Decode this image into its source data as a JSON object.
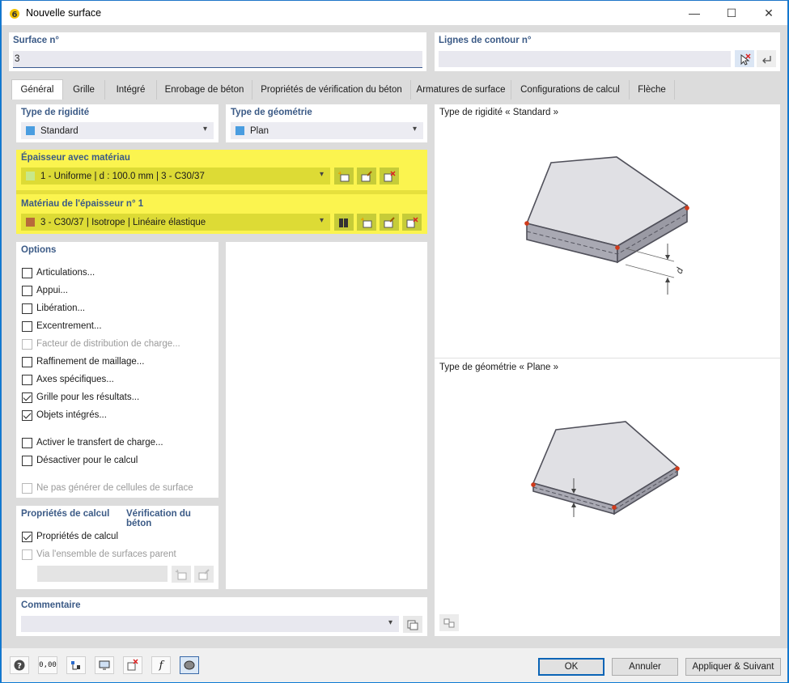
{
  "window": {
    "title": "Nouvelle surface",
    "min": "—",
    "max": "☐",
    "close": "✕"
  },
  "surface": {
    "label": "Surface n°",
    "value": "3"
  },
  "contour": {
    "label": "Lignes de contour n°",
    "value": ""
  },
  "tabs": [
    "Général",
    "Grille",
    "Intégré",
    "Enrobage de béton",
    "Propriétés de vérification du béton",
    "Armatures de surface",
    "Configurations de calcul",
    "Flèche"
  ],
  "rigidity": {
    "label": "Type de rigidité",
    "value": "Standard",
    "color": "#4a9de0"
  },
  "geometry": {
    "label": "Type de géométrie",
    "value": "Plan",
    "color": "#4a9de0"
  },
  "thickness": {
    "label": "Épaisseur avec matériau",
    "value": "1 - Uniforme | d : 100.0 mm | 3 - C30/37",
    "color": "#c8e88a"
  },
  "material": {
    "label": "Matériau de l'épaisseur n° 1",
    "value": "3 - C30/37 | Isotrope | Linéaire élastique",
    "color": "#b86a3a"
  },
  "options": {
    "label": "Options",
    "items": [
      {
        "label": "Articulations...",
        "checked": false,
        "enabled": true
      },
      {
        "label": "Appui...",
        "checked": false,
        "enabled": true
      },
      {
        "label": "Libération...",
        "checked": false,
        "enabled": true
      },
      {
        "label": "Excentrement...",
        "checked": false,
        "enabled": true
      },
      {
        "label": "Facteur de distribution de charge...",
        "checked": false,
        "enabled": false
      },
      {
        "label": "Raffinement de maillage...",
        "checked": false,
        "enabled": true
      },
      {
        "label": "Axes spécifiques...",
        "checked": false,
        "enabled": true
      },
      {
        "label": "Grille pour les résultats...",
        "checked": true,
        "enabled": true
      },
      {
        "label": "Objets intégrés...",
        "checked": true,
        "enabled": true
      },
      {
        "label": "Activer le transfert de charge...",
        "checked": false,
        "enabled": true
      },
      {
        "label": "Désactiver pour le calcul",
        "checked": false,
        "enabled": true
      },
      {
        "label": "Ne pas générer de cellules de surface",
        "checked": false,
        "enabled": false
      }
    ]
  },
  "calc": {
    "label": "Propriétés de calcul",
    "label2": "Vérification du béton",
    "items": [
      {
        "label": "Propriétés de calcul",
        "checked": true,
        "enabled": true
      },
      {
        "label": "Via l'ensemble de surfaces parent",
        "checked": false,
        "enabled": false
      }
    ]
  },
  "comment": {
    "label": "Commentaire",
    "value": ""
  },
  "preview": {
    "rigidity_caption": "Type de rigidité « Standard »",
    "geometry_caption": "Type de géométrie « Plane »",
    "dim_label": "d"
  },
  "buttons": {
    "ok": "OK",
    "cancel": "Annuler",
    "apply_next": "Appliquer & Suivant"
  },
  "footer_icons": [
    "help-icon",
    "units-icon",
    "model-icon",
    "display-icon",
    "delete-selection-icon",
    "function-icon",
    "brain-icon"
  ],
  "footer_units_text": "0,00"
}
